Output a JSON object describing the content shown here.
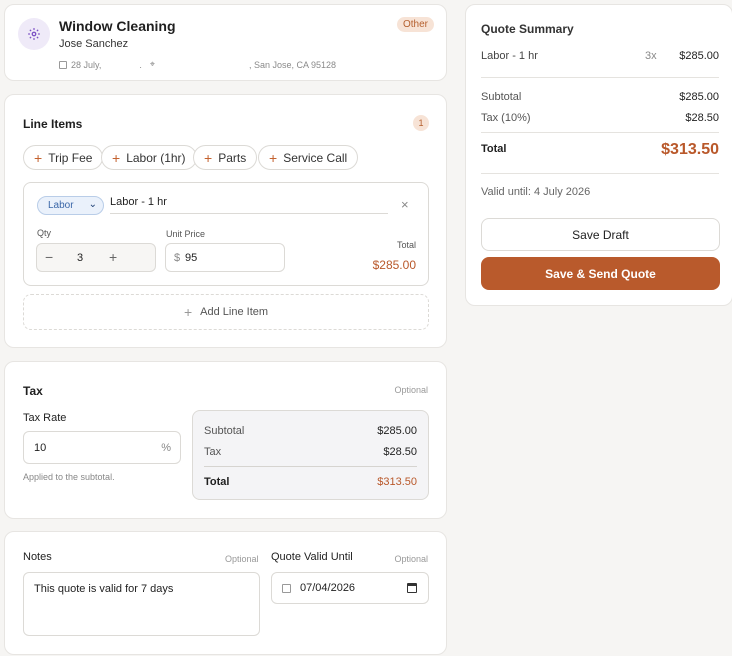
{
  "client": {
    "service": "Window Cleaning",
    "name": "Jose Sanchez",
    "date": "28 July,",
    "address_sep": ".",
    "address": ", San Jose, CA 95128",
    "badge": "Other"
  },
  "line_items": {
    "title": "Line Items",
    "count": "1",
    "quick_add": [
      "Trip Fee",
      "Labor (1hr)",
      "Parts",
      "Service Call"
    ],
    "item": {
      "type": "Labor",
      "description": "Labor - 1 hr",
      "qty_label": "Qty",
      "qty": "3",
      "unit_price_label": "Unit Price",
      "currency": "$",
      "unit_price": "95",
      "total_label": "Total",
      "total": "$285.00"
    },
    "add_label": "Add Line Item"
  },
  "tax": {
    "title": "Tax",
    "optional": "Optional",
    "rate_label": "Tax Rate",
    "rate": "10",
    "percent": "%",
    "hint": "Applied to the subtotal.",
    "subtotal_label": "Subtotal",
    "subtotal": "$285.00",
    "tax_label": "Tax",
    "tax": "$28.50",
    "total_label": "Total",
    "total": "$313.50"
  },
  "notes": {
    "title": "Notes",
    "optional": "Optional",
    "text": "This quote is valid for 7 days"
  },
  "valid_until": {
    "title": "Quote Valid Until",
    "optional": "Optional",
    "date": "07/04/2026"
  },
  "summary": {
    "title": "Quote Summary",
    "item_name": "Labor - 1 hr",
    "item_qty": "3x",
    "item_total": "$285.00",
    "subtotal_label": "Subtotal",
    "subtotal": "$285.00",
    "tax_label": "Tax (10%)",
    "tax": "$28.50",
    "total_label": "Total",
    "total": "$313.50",
    "valid_text": "Valid until: 4 July 2026",
    "save_draft": "Save Draft",
    "send": "Save & Send Quote"
  }
}
